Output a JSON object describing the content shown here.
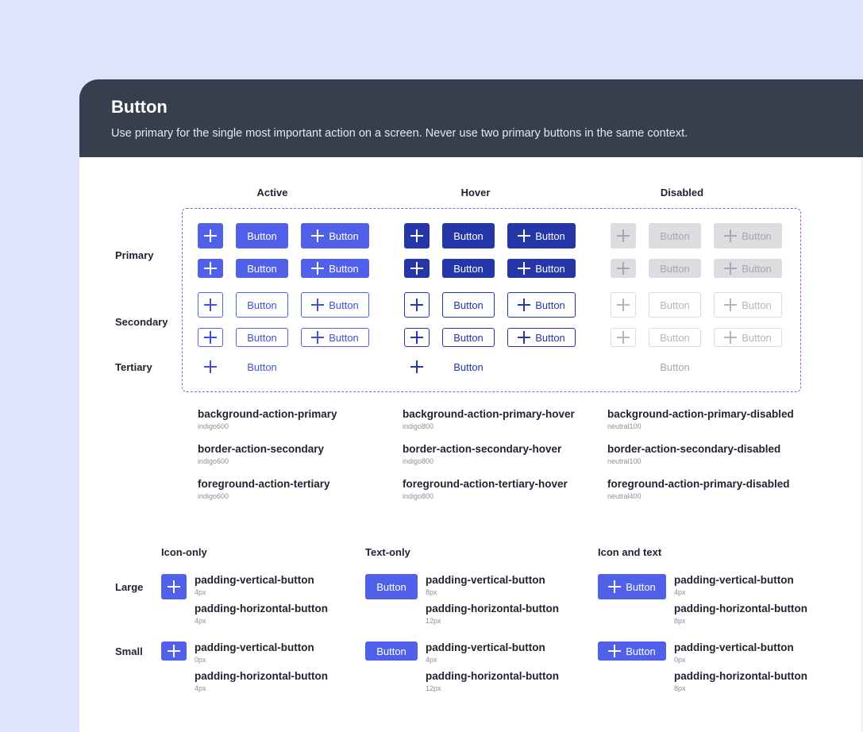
{
  "header": {
    "title": "Button",
    "description": "Use primary for the single most important action on a screen. Never use two primary buttons in the same context."
  },
  "states": {
    "active": "Active",
    "hover": "Hover",
    "disabled": "Disabled"
  },
  "rows": {
    "primary": "Primary",
    "secondary": "Secondary",
    "tertiary": "Tertiary"
  },
  "button_label": "Button",
  "tokens": {
    "active": [
      {
        "name": "background-action-primary",
        "value": "indigo600"
      },
      {
        "name": "border-action-secondary",
        "value": "indigo600"
      },
      {
        "name": "foreground-action-tertiary",
        "value": "indigo600"
      }
    ],
    "hover": [
      {
        "name": "background-action-primary-hover",
        "value": "indigo800"
      },
      {
        "name": "border-action-secondary-hover",
        "value": "indigo800"
      },
      {
        "name": "foreground-action-tertiary-hover",
        "value": "indigo800"
      }
    ],
    "disabled": [
      {
        "name": "background-action-primary-disabled",
        "value": "neutral100"
      },
      {
        "name": "border-action-secondary-disabled",
        "value": "neutral100"
      },
      {
        "name": "foreground-action-primary-disabled",
        "value": "neutral400"
      }
    ]
  },
  "sizing": {
    "columns": {
      "icon_only": "Icon-only",
      "text_only": "Text-only",
      "icon_and_text": "Icon and text"
    },
    "rows": {
      "large": "Large",
      "small": "Small"
    },
    "vertical_token": "padding-vertical-button",
    "horizontal_token": "padding-horizontal-button",
    "large": {
      "icon_only": {
        "vertical": "4px",
        "horizontal": "4px"
      },
      "text_only": {
        "vertical": "8px",
        "horizontal": "12px"
      },
      "icon_and_text": {
        "vertical": "4px",
        "horizontal": "8px"
      }
    },
    "small": {
      "icon_only": {
        "vertical": "0px",
        "horizontal": "4px"
      },
      "text_only": {
        "vertical": "4px",
        "horizontal": "12px"
      },
      "icon_and_text": {
        "vertical": "0px",
        "horizontal": "8px"
      }
    }
  },
  "colors": {
    "page_background": "#e0e3fc",
    "header_background": "#363f4e",
    "indigo600": "#5060e9",
    "indigo800": "#2536a8",
    "neutral100": "#dcdde1",
    "neutral400": "#a5a8ae",
    "dashed_outline": "#a157d8"
  },
  "icons": {
    "add": "plus-icon"
  }
}
